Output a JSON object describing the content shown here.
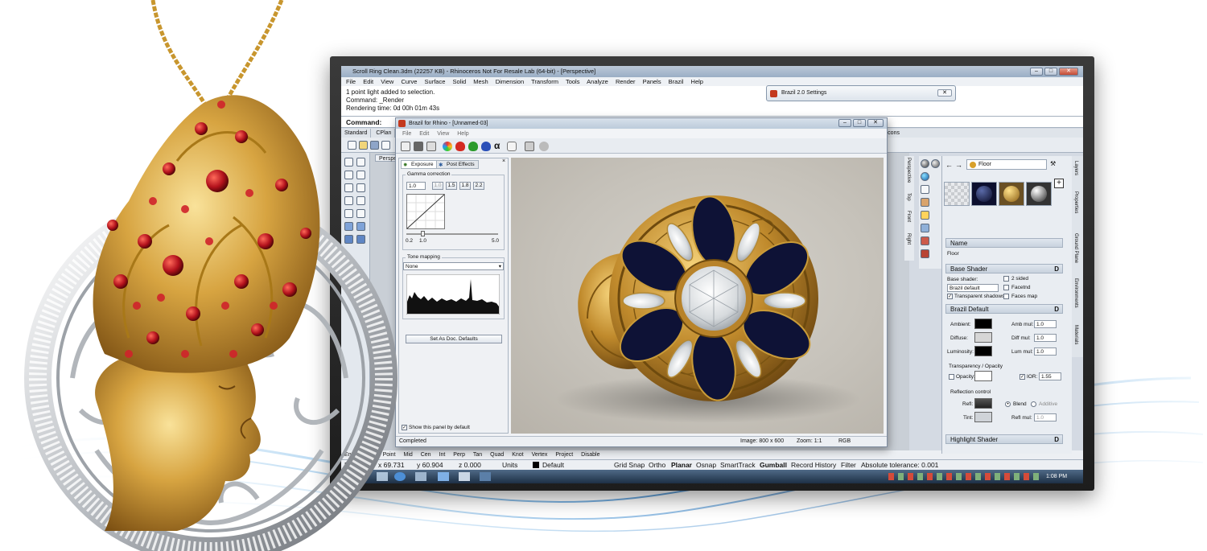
{
  "rhino": {
    "title": "Scroll Ring Clean.3dm (22257 KB) - Rhinoceros Not For Resale Lab (64-bit) - [Perspective]",
    "menu": [
      "File",
      "Edit",
      "View",
      "Curve",
      "Surface",
      "Solid",
      "Mesh",
      "Dimension",
      "Transform",
      "Tools",
      "Analyze",
      "Render",
      "Panels",
      "Brazil",
      "Help"
    ],
    "history": [
      "1 point light added to selection.",
      "Command: _Render",
      "Rendering time: 0d 00h 01m 43s"
    ],
    "command_label": "Command:",
    "toolbar_tabs": [
      "Standard",
      "CPlan"
    ],
    "tabstrip_right": "al 1 Icons",
    "viewport_tab": "Perspe",
    "osnap": [
      "End",
      "Near",
      "Point",
      "Mid",
      "Cen",
      "Int",
      "Perp",
      "Tan",
      "Quad",
      "Knot",
      "Vertex",
      "Project",
      "Disable"
    ],
    "status": {
      "plane": "Plane",
      "x": "x 69.731",
      "y": "y 60.904",
      "z": "z 0.000",
      "units": "Units",
      "layer": "Default",
      "grid_snap": "Grid Snap",
      "ortho": "Ortho",
      "planar": "Planar",
      "osnap": "Osnap",
      "smarttrack": "SmartTrack",
      "gumball": "Gumball",
      "record_history": "Record History",
      "filter": "Filter",
      "tolerance": "Absolute tolerance: 0.001"
    },
    "clock": "1:08 PM"
  },
  "brazil_settings": {
    "title": "Brazil 2.0 Settings"
  },
  "brazil_window": {
    "title": "Brazil for Rhino - [Unnamed-03]",
    "menu": [
      "File",
      "Edit",
      "View",
      "Help"
    ],
    "tabs": [
      "Exposure",
      "Post Effects"
    ],
    "gamma_title": "Gamma correction",
    "gamma_value": "1.0",
    "gamma_presets": [
      "1.0",
      "1.5",
      "1.8",
      "2.2"
    ],
    "curve_ticks": [
      "0.2",
      "1.0",
      "5.0"
    ],
    "tone_title": "Tone mapping",
    "tone_value": "None",
    "defaults_button": "Set As Doc. Defaults",
    "show_panel": "Show this panel by default",
    "status_completed": "Completed",
    "status_image": "Image: 800 x 600",
    "status_zoom": "Zoom: 1:1",
    "status_mode": "RGB"
  },
  "materials": {
    "current": "Floor",
    "name_header": "Name",
    "name_value": "Floor",
    "base_shader_title": "Base Shader",
    "base_shader_label": "Base shader:",
    "base_shader_value": "Brazil default",
    "two_sided": "2 sided",
    "facet": "Facetnd",
    "transparent_shadows": "Transparent shadows",
    "faces": "Faces map",
    "brazil_default_title": "Brazil Default",
    "ambient": "Ambient:",
    "diffuse": "Diffuse:",
    "luminosity": "Luminosity:",
    "amb_mul": "Amb mul:",
    "diff_mul": "Diff mul:",
    "lum_mul": "Lum mul:",
    "mul_value": "1.0",
    "transparency_title": "Transparency / Opacity",
    "opacity": "Opacity:",
    "ior": "IOR:",
    "ior_value": "1.55",
    "reflection_title": "Reflection control",
    "refl": "Refl:",
    "blend": "Blend",
    "additive": "Additive",
    "tint": "Tint:",
    "refl_mul": "Refl mul:",
    "highlight_title": "Highlight Shader",
    "section_ctl": "D",
    "right_tabs": [
      "Layers",
      "Properties",
      "Ground Plane",
      "Environments",
      "Materials"
    ],
    "side_tabs": [
      "Perspective",
      "Top",
      "Front",
      "Right"
    ]
  },
  "colors": {
    "gold": "#c79a33",
    "ruby": "#b3121c",
    "enamel": "#0e1236",
    "swoosh": "#2a7fc9"
  }
}
